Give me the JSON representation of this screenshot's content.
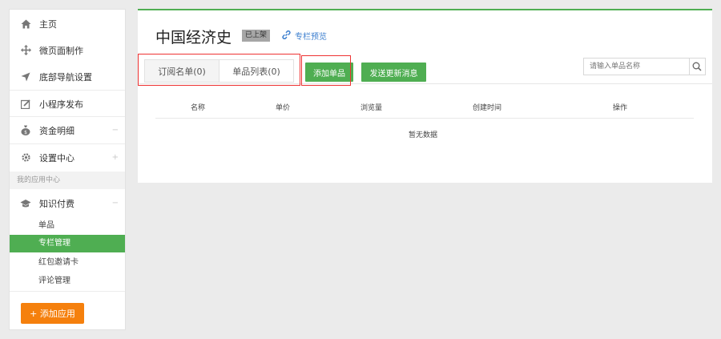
{
  "sidebar": {
    "items": [
      {
        "label": "主页",
        "icon": "home-icon"
      },
      {
        "label": "微页面制作",
        "icon": "move-arrows-icon"
      },
      {
        "label": "底部导航设置",
        "icon": "navigation-arrow-icon"
      },
      {
        "label": "小程序发布",
        "icon": "edit-square-icon"
      },
      {
        "label": "资金明细",
        "icon": "money-bag-icon",
        "expand": "−"
      },
      {
        "label": "设置中心",
        "icon": "gear-icon",
        "expand": "+"
      }
    ],
    "section_label": "我的应用中心",
    "apps": [
      {
        "label": "知识付费",
        "icon": "graduation-cap-icon",
        "expand": "−"
      }
    ],
    "sub_items": [
      "单品",
      "专栏管理",
      "红包邀请卡",
      "评论管理"
    ],
    "active_sub": "专栏管理",
    "add_app_label": "+ 添加应用"
  },
  "main": {
    "title": "中国经济史",
    "status": "已上架",
    "preview_label": "专栏预览",
    "tabs": [
      "订阅名单(0)",
      "单品列表(0)"
    ],
    "add_item_label": "添加单品",
    "send_update_label": "发送更新消息",
    "search_placeholder": "请输入单品名称",
    "columns": [
      "名称",
      "单价",
      "浏览量",
      "创建时间",
      "操作"
    ],
    "empty_text": "暂无数据"
  },
  "colors": {
    "accent_green": "#4fae52",
    "orange": "#f5800d",
    "link_blue": "#3d7fcf",
    "highlight_red": "#ee3333"
  }
}
